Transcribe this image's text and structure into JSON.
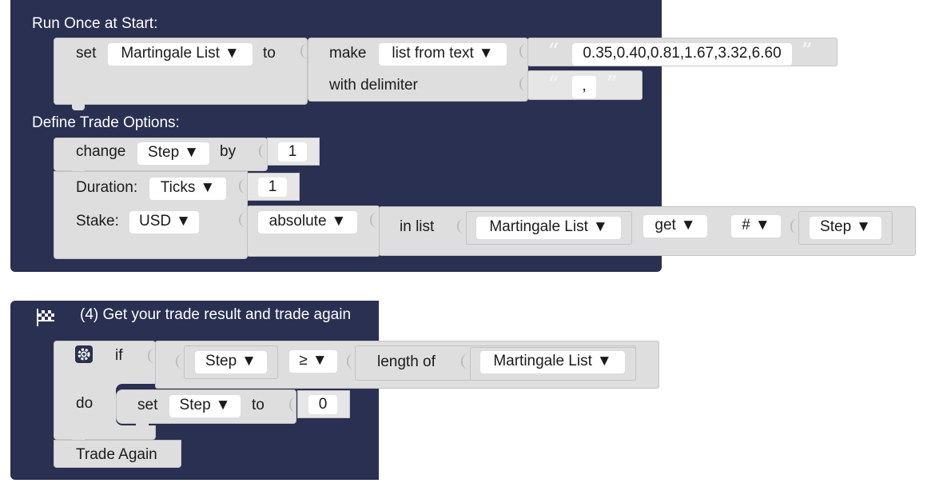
{
  "colors": {
    "hat_block": "#2a3052",
    "block": "#dedede",
    "field": "#ffffff"
  },
  "block1": {
    "run_once_label": "Run Once at Start:",
    "set_keyword": "set",
    "var_list": "Martingale List",
    "to_keyword": "to",
    "make_keyword": "make",
    "list_mode": "list from text",
    "list_text": "0.35,0.40,0.81,1.67,3.32,6.60",
    "with_delimiter_label": "with delimiter",
    "delimiter": ",",
    "define_trade_label": "Define Trade Options:",
    "change_keyword": "change",
    "var_step": "Step",
    "by_keyword": "by",
    "change_value": "1",
    "duration_label": "Duration:",
    "duration_unit": "Ticks",
    "duration_value": "1",
    "stake_label": "Stake:",
    "currency": "USD",
    "absolute": "absolute",
    "in_list_label": "in list",
    "list_var": "Martingale List",
    "get_mode": "get",
    "index_mode": "#",
    "index_var": "Step"
  },
  "block2": {
    "title": "(4) Get your trade result and trade again",
    "flag_icon": "checkered-flag-icon",
    "gear_icon": "gear-icon",
    "if_keyword": "if",
    "cond_var": "Step",
    "operator": "≥",
    "length_of_label": "length of",
    "length_var": "Martingale List",
    "do_keyword": "do",
    "set_keyword": "set",
    "set_var": "Step",
    "to_keyword": "to",
    "set_value": "0",
    "trade_again_label": "Trade Again"
  },
  "dropdown_arrow": "▼",
  "quote_open": "“",
  "quote_close": "”"
}
